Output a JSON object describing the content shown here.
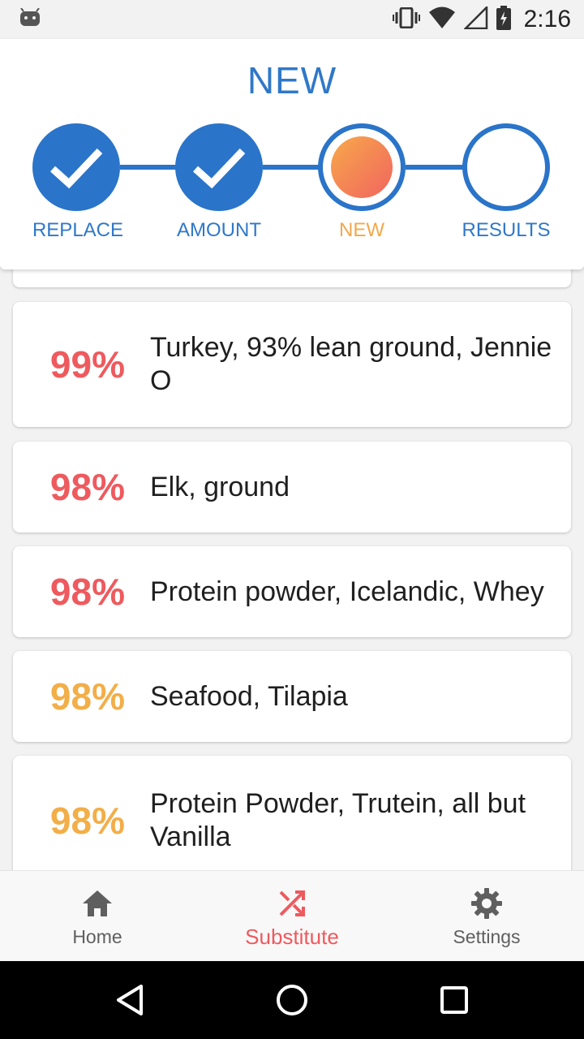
{
  "stepper": {
    "title": "NEW",
    "steps": [
      {
        "label": "REPLACE",
        "state": "done"
      },
      {
        "label": "AMOUNT",
        "state": "done"
      },
      {
        "label": "NEW",
        "state": "current"
      },
      {
        "label": "RESULTS",
        "state": "pending"
      }
    ]
  },
  "status_bar": {
    "time": "2:16",
    "icons": [
      "android-debug-icon",
      "vibrate-icon",
      "wifi-icon",
      "signal-icon",
      "battery-charging-icon"
    ]
  },
  "results": [
    {
      "percent": "99%",
      "name": "Turkey, 93% lean ground, Jennie O",
      "color": "#ee5a5e"
    },
    {
      "percent": "98%",
      "name": "Elk, ground",
      "color": "#ee5a5e"
    },
    {
      "percent": "98%",
      "name": "Protein powder, Icelandic, Whey",
      "color": "#ee5a5e"
    },
    {
      "percent": "98%",
      "name": "Seafood, Tilapia",
      "color": "#f2ae48"
    },
    {
      "percent": "98%",
      "name": "Protein Powder, Trutein, all but Vanilla",
      "color": "#f2ae48"
    }
  ],
  "bottom_nav": {
    "items": [
      {
        "label": "Home",
        "icon": "home-icon",
        "active": false
      },
      {
        "label": "Substitute",
        "icon": "shuffle-icon",
        "active": true
      },
      {
        "label": "Settings",
        "icon": "gear-icon",
        "active": false
      }
    ]
  },
  "colors": {
    "accent_blue": "#2a74c9",
    "active_red": "#ee5a5e",
    "current_orange": "#f2ae48"
  }
}
